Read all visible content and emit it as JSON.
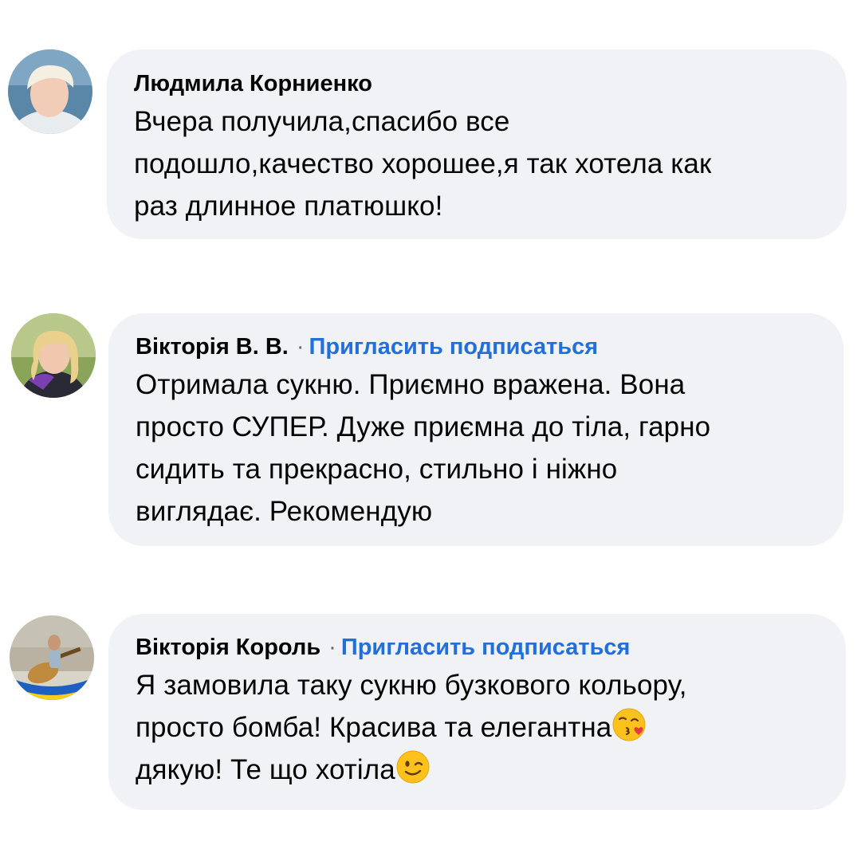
{
  "comments": [
    {
      "author": "Людмила Корниенко",
      "invite_label": "",
      "lines": [
        "Вчера получила,спасибо все",
        "подошло,качество хорошее,я так хотела как",
        "раз длинное платюшко!"
      ]
    },
    {
      "author": "Вікторія В. В.",
      "separator": "·",
      "invite_label": "Пригласить подписаться",
      "lines": [
        "Отримала сукню. Приємно вражена. Вона",
        "просто СУПЕР.  Дуже приємна до тіла, гарно",
        "сидить та прекрасно, стильно і ніжно",
        "виглядає. Рекомендую"
      ]
    },
    {
      "author": "Вікторія Король",
      "separator": "·",
      "invite_label": "Пригласить подписаться",
      "lines": [
        "Я замовила таку сукню бузкового кольору,",
        "просто бомба! Красива та елегантна",
        "дякую! Те що хотіла"
      ],
      "emojis": [
        "face-blowing-kiss-icon",
        "winking-face-icon"
      ]
    }
  ],
  "colors": {
    "bubble": "#f0f2f5",
    "invite_link": "#216fdb",
    "text": "#050505"
  }
}
